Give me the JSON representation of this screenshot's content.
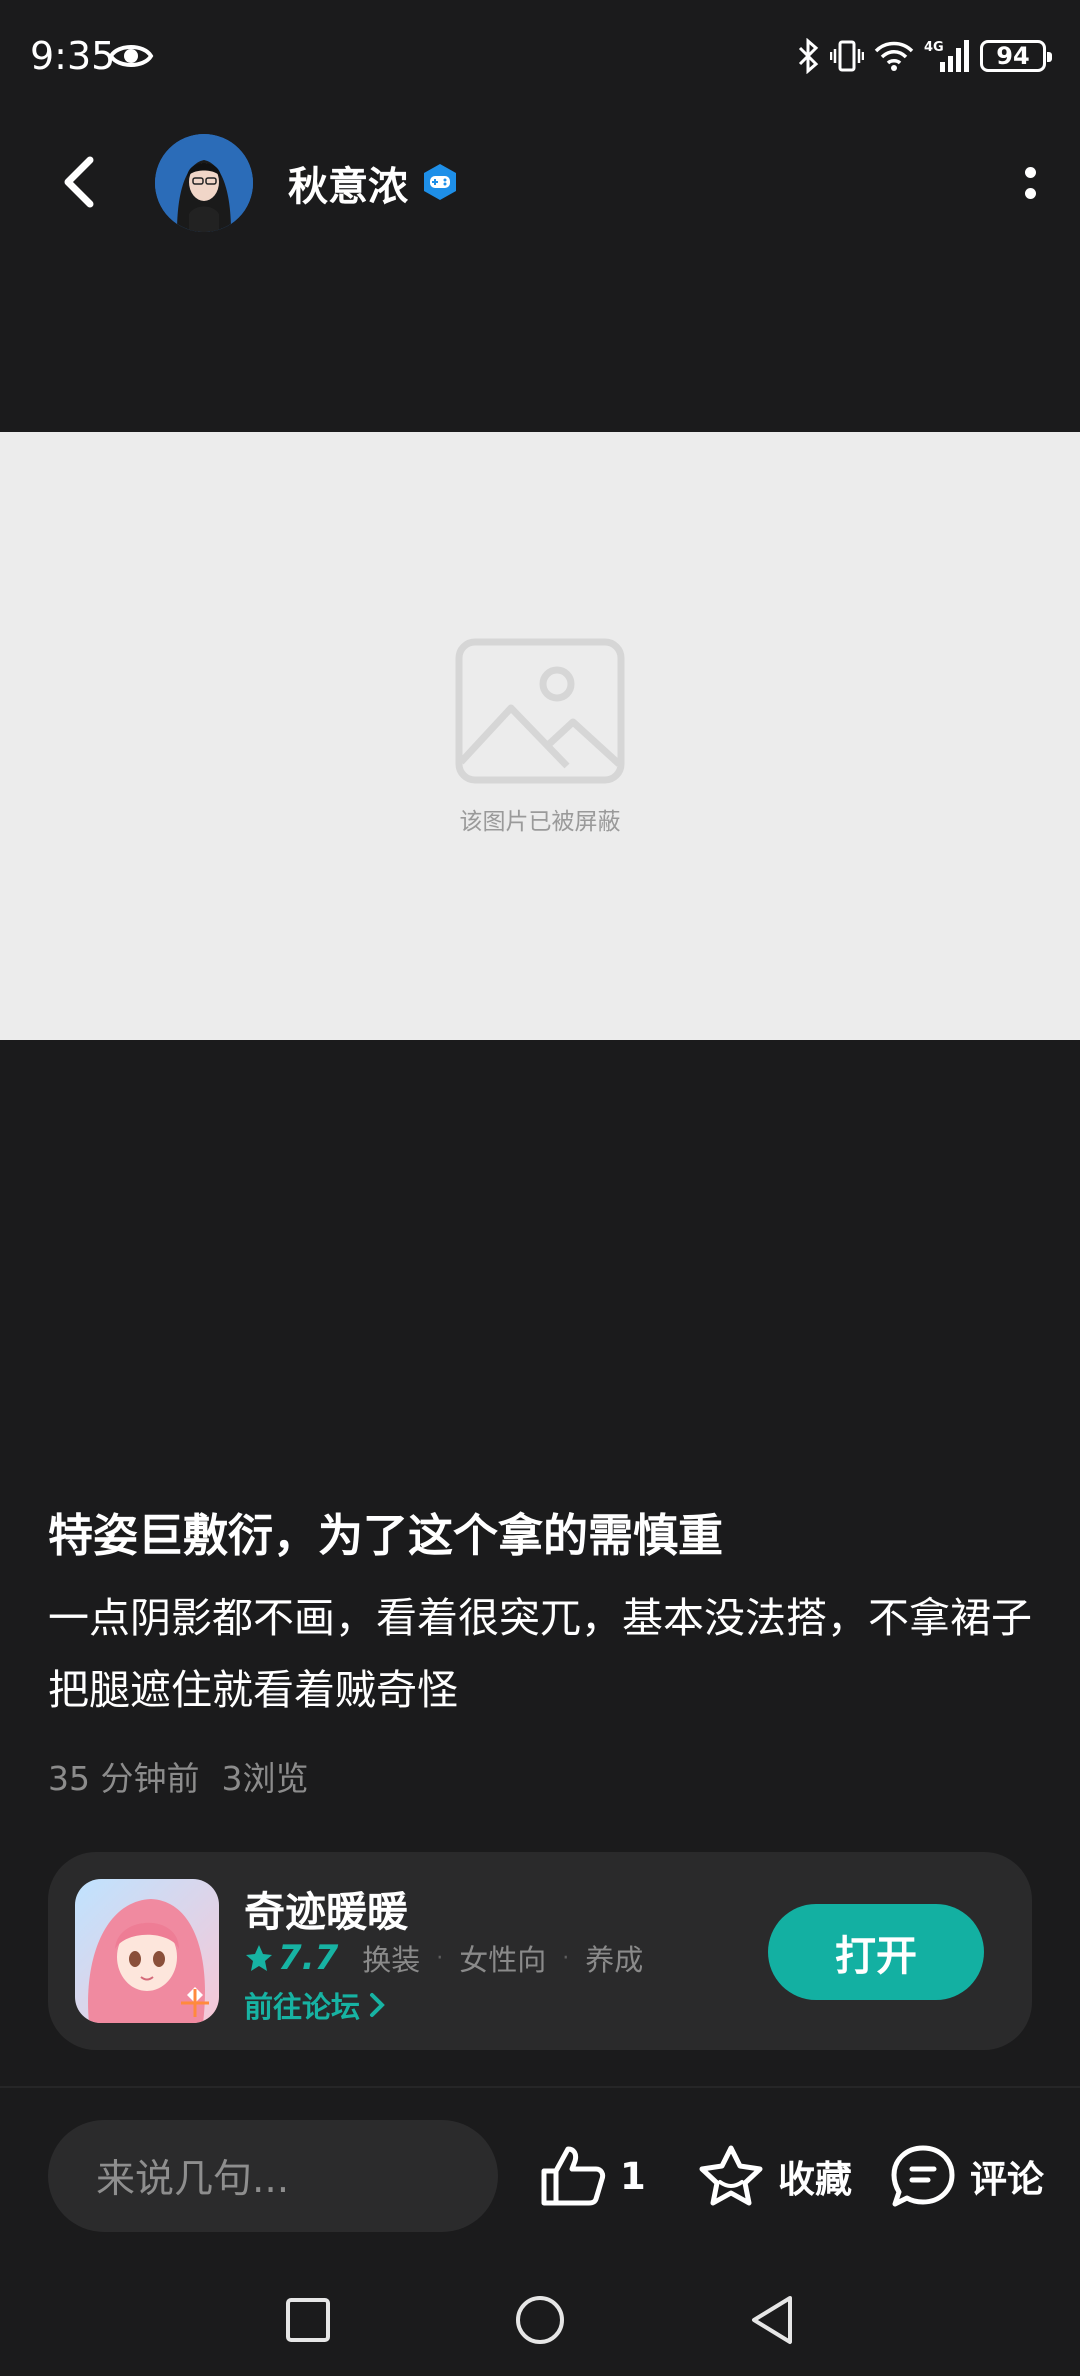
{
  "status_bar": {
    "time": "9:35",
    "network": "4G",
    "battery": "94"
  },
  "header": {
    "user_name": "秋意浓",
    "icons": [
      "back-icon",
      "avatar",
      "verified-game-badge-icon",
      "more-vertical-icon"
    ]
  },
  "blocked_image": {
    "text": "该图片已被屏蔽",
    "icon": "image-placeholder-icon"
  },
  "post": {
    "title": "特姿巨敷衍，为了这个拿的需慎重",
    "body": "一点阴影都不画，看着很突兀，基本没法搭，不拿裙子把腿遮住就看着贼奇怪",
    "time_ago": "35 分钟前",
    "views": "3浏览"
  },
  "game_card": {
    "name": "奇迹暖暖",
    "rating": "7.7",
    "tags": [
      "换装",
      "女性向",
      "养成"
    ],
    "forum_link": "前往论坛",
    "open_button": "打开",
    "accent_color": "#13b0a2"
  },
  "bottom_bar": {
    "comment_placeholder": "来说几句...",
    "like_count": "1",
    "favorite_label": "收藏",
    "comment_label": "评论"
  }
}
